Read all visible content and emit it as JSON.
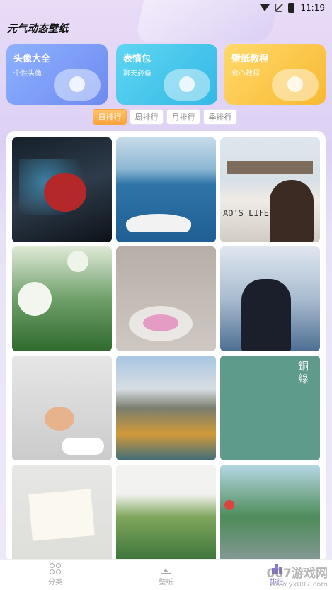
{
  "status_bar": {
    "time": "11:19"
  },
  "app": {
    "title": "元气动态壁纸"
  },
  "cards": [
    {
      "title": "头像大全",
      "subtitle": "个性头像",
      "color": "#7a9cf6"
    },
    {
      "title": "表情包",
      "subtitle": "聊天必备",
      "color": "#45c6ec"
    },
    {
      "title": "壁纸教程",
      "subtitle": "省心教程",
      "color": "#fbc94a"
    }
  ],
  "rank_tabs": [
    {
      "label": "日排行",
      "active": true
    },
    {
      "label": "周排行",
      "active": false
    },
    {
      "label": "月排行",
      "active": false
    },
    {
      "label": "季排行",
      "active": false
    }
  ],
  "wallpapers": {
    "sign_text": "AO'S LIFE",
    "green_tile_text": "銅綠"
  },
  "bottom_nav": [
    {
      "label": "分类",
      "icon": "category-grid-icon",
      "active": false
    },
    {
      "label": "壁纸",
      "icon": "wallpaper-image-icon",
      "active": false
    },
    {
      "label": "排行",
      "icon": "ranking-bars-icon",
      "active": true
    }
  ],
  "watermark": {
    "brand": "007游戏网",
    "url": "www.yx007.com"
  },
  "colors": {
    "accent": "#8a77d8",
    "active_tab": "#f9a43d"
  }
}
